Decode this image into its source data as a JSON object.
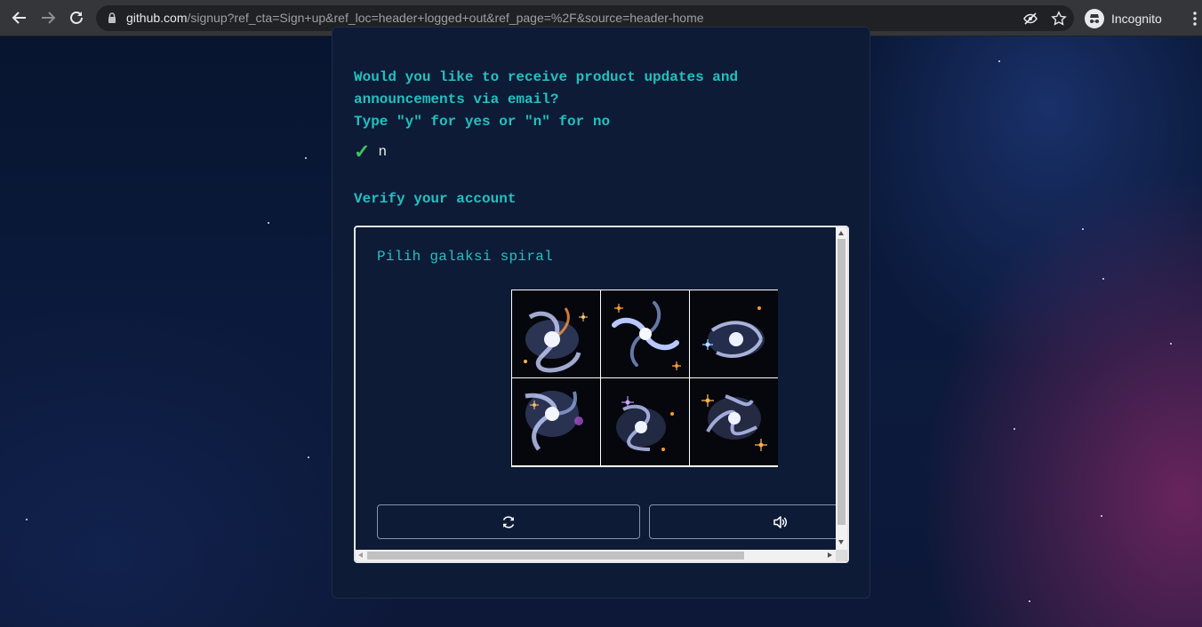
{
  "browser": {
    "url_host": "github.com",
    "url_rest": "/signup?ref_cta=Sign+up&ref_loc=header+logged+out&ref_page=%2F&source=header-home",
    "profile_label": "Incognito"
  },
  "signup": {
    "question_lines": [
      "Would you like to receive product updates and",
      "announcements via email?",
      "Type \"y\" for yes or \"n\" for no"
    ],
    "answer_mark": "✓",
    "answer": "n",
    "verify_title": "Verify your account"
  },
  "captcha": {
    "prompt": "Pilih galaksi spiral",
    "tiles": [
      "galaxy-image-1",
      "galaxy-image-2",
      "galaxy-image-3",
      "galaxy-image-4",
      "galaxy-image-5",
      "galaxy-image-6"
    ],
    "reload_icon": "reload-icon",
    "audio_icon": "speaker-icon"
  },
  "colors": {
    "accent_teal": "#24c0c0",
    "check_green": "#3ec55b",
    "card_bg": "#0d1b36"
  }
}
